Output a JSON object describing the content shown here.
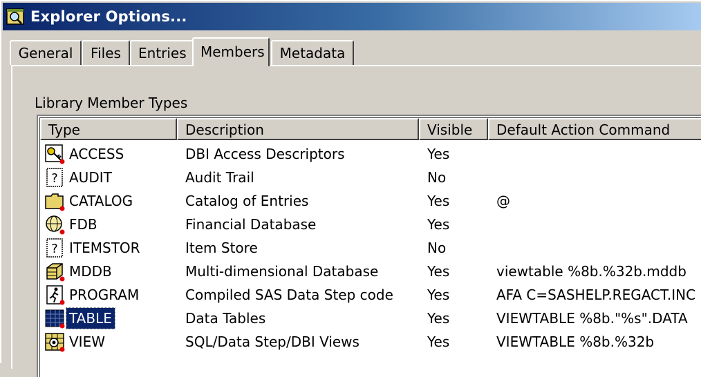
{
  "window": {
    "title": "Explorer Options..."
  },
  "tabs": [
    {
      "label": "General"
    },
    {
      "label": "Files"
    },
    {
      "label": "Entries"
    },
    {
      "label": "Members"
    },
    {
      "label": "Metadata"
    }
  ],
  "active_tab": "Members",
  "group": {
    "label": "Library Member Types"
  },
  "columns": {
    "type": "Type",
    "description": "Description",
    "visible": "Visible",
    "command": "Default Action Command"
  },
  "rows": [
    {
      "type": "ACCESS",
      "description": "DBI Access Descriptors",
      "visible": "Yes",
      "command": "",
      "icon": "access-key-icon"
    },
    {
      "type": "AUDIT",
      "description": "Audit Trail",
      "visible": "No",
      "command": "",
      "icon": "question-icon"
    },
    {
      "type": "CATALOG",
      "description": "Catalog of Entries",
      "visible": "Yes",
      "command": "@",
      "icon": "folder-icon"
    },
    {
      "type": "FDB",
      "description": "Financial Database",
      "visible": "Yes",
      "command": "",
      "icon": "globe-icon"
    },
    {
      "type": "ITEMSTOR",
      "description": "Item Store",
      "visible": "No",
      "command": "",
      "icon": "question-icon"
    },
    {
      "type": "MDDB",
      "description": "Multi-dimensional Database",
      "visible": "Yes",
      "command": "viewtable %8b.%32b.mddb",
      "icon": "cube-icon"
    },
    {
      "type": "PROGRAM",
      "description": "Compiled SAS Data Step code",
      "visible": "Yes",
      "command": "AFA C=SASHELP.REGACT.INC",
      "icon": "runner-icon"
    },
    {
      "type": "TABLE",
      "description": "Data Tables",
      "visible": "Yes",
      "command": "VIEWTABLE %8b.\"%s\".DATA",
      "icon": "table-icon"
    },
    {
      "type": "VIEW",
      "description": "SQL/Data Step/DBI Views",
      "visible": "Yes",
      "command": "VIEWTABLE %8b.%32b",
      "icon": "view-icon"
    }
  ],
  "selected_row": "TABLE",
  "colors": {
    "selection": "#0a246a",
    "titlebar_start": "#0a246a",
    "titlebar_end": "#a6caf0",
    "face": "#d4d0c8",
    "badge": "#e00000"
  }
}
